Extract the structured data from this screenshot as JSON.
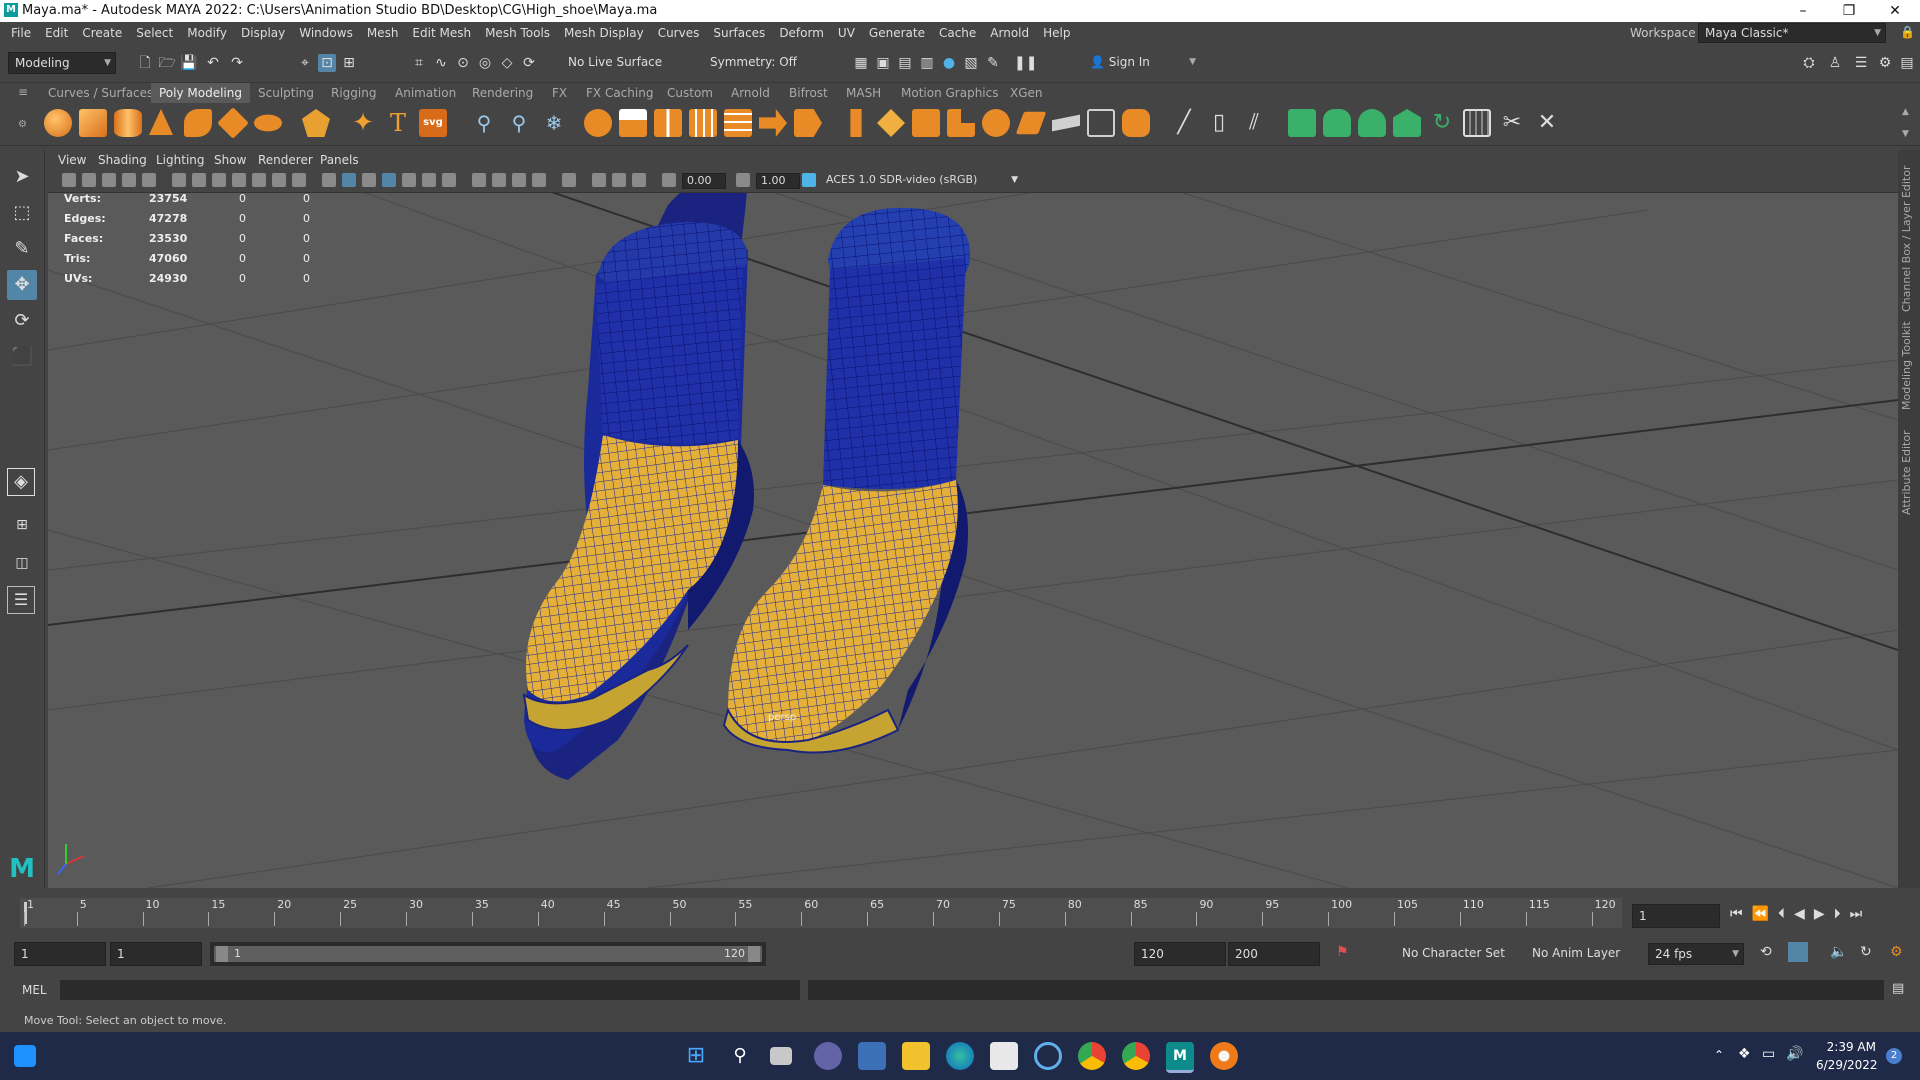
{
  "window": {
    "title": "Maya.ma* - Autodesk MAYA 2022: C:\\Users\\Animation Studio BD\\Desktop\\CG\\High_shoe\\Maya.ma",
    "app_icon": "M",
    "controls": [
      "–",
      "❐",
      "✕"
    ]
  },
  "menubar": {
    "items": [
      "File",
      "Edit",
      "Create",
      "Select",
      "Modify",
      "Display",
      "Windows",
      "Mesh",
      "Edit Mesh",
      "Mesh Tools",
      "Mesh Display",
      "Curves",
      "Surfaces",
      "Deform",
      "UV",
      "Generate",
      "Cache",
      "Arnold",
      "Help"
    ],
    "workspace_label": "Workspace :",
    "workspace_value": "Maya Classic*"
  },
  "statusline": {
    "mode": "Modeling",
    "live_surface": "No Live Surface",
    "symmetry": "Symmetry: Off",
    "sign_in": "Sign In"
  },
  "shelf": {
    "tabs": [
      "Curves / Surfaces",
      "Poly Modeling",
      "Sculpting",
      "Rigging",
      "Animation",
      "Rendering",
      "FX",
      "FX Caching",
      "Custom",
      "Arnold",
      "Bifrost",
      "MASH",
      "Motion Graphics",
      "XGen"
    ],
    "active_tab": "Poly Modeling",
    "svg_label": "svg",
    "text_label": "T"
  },
  "viewport": {
    "menu": [
      "View",
      "Shading",
      "Lighting",
      "Show",
      "Renderer",
      "Panels"
    ],
    "exposure": "0.00",
    "gamma": "1.00",
    "colorspace": "ACES 1.0 SDR-video (sRGB)",
    "camera_label": "persp",
    "hud": [
      {
        "label": "Verts:",
        "v1": "23754",
        "v2": "0",
        "v3": "0"
      },
      {
        "label": "Edges:",
        "v1": "47278",
        "v2": "0",
        "v3": "0"
      },
      {
        "label": "Faces:",
        "v1": "23530",
        "v2": "0",
        "v3": "0"
      },
      {
        "label": "Tris:",
        "v1": "47060",
        "v2": "0",
        "v3": "0"
      },
      {
        "label": "UVs:",
        "v1": "24930",
        "v2": "0",
        "v3": "0"
      }
    ]
  },
  "right_panel": {
    "labels": [
      "Channel Box / Layer Editor",
      "Modeling Toolkit",
      "Attribute Editor"
    ]
  },
  "timeline": {
    "ticks": [
      "1",
      "5",
      "10",
      "15",
      "20",
      "25",
      "30",
      "35",
      "40",
      "45",
      "50",
      "55",
      "60",
      "65",
      "70",
      "75",
      "80",
      "85",
      "90",
      "95",
      "100",
      "105",
      "110",
      "115",
      "120"
    ],
    "current_frame": "1"
  },
  "range": {
    "start": "1",
    "playback_start": "1",
    "slider_start": "1",
    "slider_end": "120",
    "playback_end": "120",
    "end": "200",
    "character_set": "No Character Set",
    "anim_layer": "No Anim Layer",
    "fps": "24 fps"
  },
  "cmdline": {
    "label": "MEL"
  },
  "helpline": {
    "text": "Move Tool: Select an object to move."
  },
  "taskbar": {
    "time": "2:39 AM",
    "date": "6/29/2022",
    "notification_count": "2"
  }
}
